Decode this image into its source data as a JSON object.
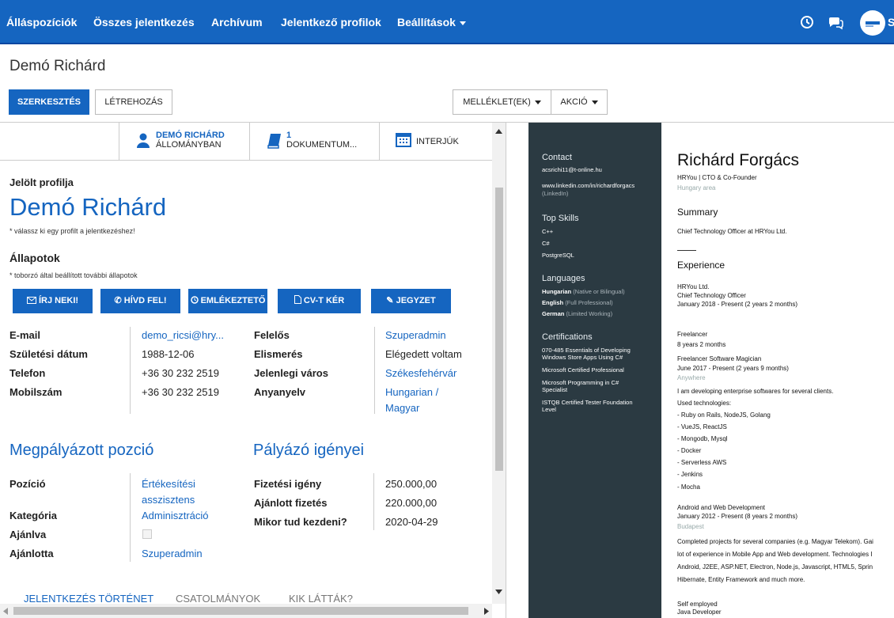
{
  "nav": {
    "items": [
      "Álláspozíciók",
      "Összes jelentkezés",
      "Archívum",
      "Jelentkező profilok",
      "Beállítások"
    ],
    "avatar_letter": "S"
  },
  "page": {
    "title": "Demó Richárd",
    "edit": "SZERKESZTÉS",
    "create": "LÉTREHOZÁS",
    "attachments": "MELLÉKLET(EK)",
    "action": "AKCIÓ"
  },
  "tabs": {
    "person_name": "DEMÓ RICHÁRD",
    "person_status": "ÁLLOMÁNYBAN",
    "docs_count": "1",
    "docs_label": "DOKUMENTUM...",
    "interviews": "INTERJÚK"
  },
  "profile": {
    "section": "Jelölt profilja",
    "name": "Demó Richárd",
    "name_note": "* válassz ki egy profilt a jelentkezéshez!",
    "states_title": "Állapotok",
    "states_note": "* toborzó által beállított további állapotok"
  },
  "actions": {
    "write": "ÍRJ NEKI!",
    "call": "HÍVD FEL!",
    "reminder": "EMLÉKEZTETŐ",
    "cv": "CV-T KÉR",
    "note": "JEGYZET"
  },
  "details_left": [
    {
      "label": "E-mail",
      "value": "demo_ricsi@hry..."
    },
    {
      "label": "Születési dátum",
      "value": "1988-12-06"
    },
    {
      "label": "Telefon",
      "value": "+36 30 232 2519"
    },
    {
      "label": "Mobilszám",
      "value": "+36 30 232 2519"
    }
  ],
  "details_right": [
    {
      "label": "Felelős",
      "value": "Szuperadmin"
    },
    {
      "label": "Elismerés",
      "value": "Elégedett voltam"
    },
    {
      "label": "Jelenlegi város",
      "value": "Székesfehérvár"
    },
    {
      "label": "Anyanyelv",
      "value": "Hungarian /",
      "value2": "Magyar"
    }
  ],
  "applied": {
    "title": "Megpályázott pozció",
    "position_label": "Pozíció",
    "position_value": "Értékesítési",
    "position_value2": "asszisztens",
    "category_label": "Kategória",
    "category_value": "Adminisztráció",
    "recommended_label": "Ajánlva",
    "recommender_label": "Ajánlotta",
    "recommender_value": "Szuperadmin"
  },
  "needs": {
    "title": "Pályázó igényei",
    "salary_label": "Fizetési igény",
    "salary_value": "250.000,00",
    "offered_label": "Ajánlott fizetés",
    "offered_value": "220.000,00",
    "start_label": "Mikor tud kezdeni?",
    "start_value": "2020-04-29"
  },
  "bottom_tabs": [
    "JELENTKEZÉS TÖRTÉNET",
    "CSATOLMÁNYOK",
    "KIK LÁTTÁK?"
  ],
  "cv": {
    "contact_h": "Contact",
    "email": "acsrichi11@t-online.hu",
    "linkedin": "www.linkedin.com/in/richardforgacs",
    "linkedin_note": "(LinkedIn)",
    "skills_h": "Top Skills",
    "skills": [
      "C++",
      "C#",
      "PostgreSQL"
    ],
    "languages_h": "Languages",
    "languages": [
      {
        "name": "Hungarian",
        "level": "(Native or Bilingual)"
      },
      {
        "name": "English",
        "level": "(Full Professional)"
      },
      {
        "name": "German",
        "level": "(Limited Working)"
      }
    ],
    "certs_h": "Certifications",
    "certs": [
      "070-485 Essentials of Developing",
      "Windows Store Apps Using C#",
      "Microsoft Certified Professional",
      "Microsoft Programming in C#",
      "Specialist",
      "ISTQB Certified Tester Foundation",
      "Level"
    ],
    "name": "Richárd Forgács",
    "headline": "HRYou | CTO & Co-Founder",
    "location": "Hungary area",
    "summary_h": "Summary",
    "summary": "Chief Technology Officer at HRYou Ltd.",
    "experience_h": "Experience",
    "exp1_company": "HRYou Ltd.",
    "exp1_role": "Chief Technology Officer",
    "exp1_dates": "January 2018 - Present (2 years 2 months)",
    "exp2_company": "Freelancer",
    "exp2_total": "8 years 2 months",
    "exp2_role": "Freelancer Software Magician",
    "exp2_dates": "June 2017 - Present (2 years 9 months)",
    "exp2_location": "Anywhere",
    "exp2_desc": "I am developing enterprise softwares for several clients.",
    "exp2_tech_h": "Used technologies:",
    "exp2_tech": [
      "- Ruby on Rails, NodeJS, Golang",
      "- VueJS, ReactJS",
      "- Mongodb, Mysql",
      "- Docker",
      "- Serverless AWS",
      "- Jenkins",
      "- Mocha"
    ],
    "exp3_role": "Android and Web Development",
    "exp3_dates": "January 2012 - Present (8 years 2 months)",
    "exp3_location": "Budapest",
    "exp3_desc": [
      "Completed projects for several companies (e.g. Magyar Telekom). Gai",
      "lot of experience in Mobile App and Web development. Technologies I",
      "Android, J2EE, ASP.NET, Electron, Node.js, Javascript, HTML5, Sprin",
      "Hibernate, Entity Framework and much more."
    ],
    "exp4_company": "Self employed",
    "exp4_role": "Java Developer"
  },
  "colors": {
    "primary": "#1565c0",
    "cv_sidebar": "#2b3a42"
  }
}
